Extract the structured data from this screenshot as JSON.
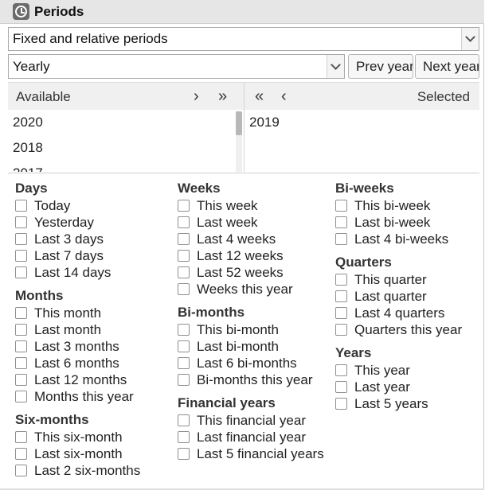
{
  "header": {
    "title": "Periods",
    "icon": "clock-icon"
  },
  "period_type": {
    "value": "Fixed and relative periods"
  },
  "period_subtype": {
    "value": "Yearly"
  },
  "buttons": {
    "prev": "Prev year",
    "next": "Next year"
  },
  "list": {
    "available_label": "Available",
    "selected_label": "Selected",
    "available_items": [
      "2020",
      "2018",
      "2017"
    ],
    "selected_items": [
      "2019"
    ]
  },
  "relative": {
    "days": {
      "title": "Days",
      "options": [
        "Today",
        "Yesterday",
        "Last 3 days",
        "Last 7 days",
        "Last 14 days"
      ]
    },
    "months": {
      "title": "Months",
      "options": [
        "This month",
        "Last month",
        "Last 3 months",
        "Last 6 months",
        "Last 12 months",
        "Months this year"
      ]
    },
    "six_months": {
      "title": "Six-months",
      "options": [
        "This six-month",
        "Last six-month",
        "Last 2 six-months"
      ]
    },
    "weeks": {
      "title": "Weeks",
      "options": [
        "This week",
        "Last week",
        "Last 4 weeks",
        "Last 12 weeks",
        "Last 52 weeks",
        "Weeks this year"
      ]
    },
    "bi_months": {
      "title": "Bi-months",
      "options": [
        "This bi-month",
        "Last bi-month",
        "Last 6 bi-months",
        "Bi-months this year"
      ]
    },
    "financial_years": {
      "title": "Financial years",
      "options": [
        "This financial year",
        "Last financial year",
        "Last 5 financial years"
      ]
    },
    "bi_weeks": {
      "title": "Bi-weeks",
      "options": [
        "This bi-week",
        "Last bi-week",
        "Last 4 bi-weeks"
      ]
    },
    "quarters": {
      "title": "Quarters",
      "options": [
        "This quarter",
        "Last quarter",
        "Last 4 quarters",
        "Quarters this year"
      ]
    },
    "years": {
      "title": "Years",
      "options": [
        "This year",
        "Last year",
        "Last 5 years"
      ]
    }
  }
}
